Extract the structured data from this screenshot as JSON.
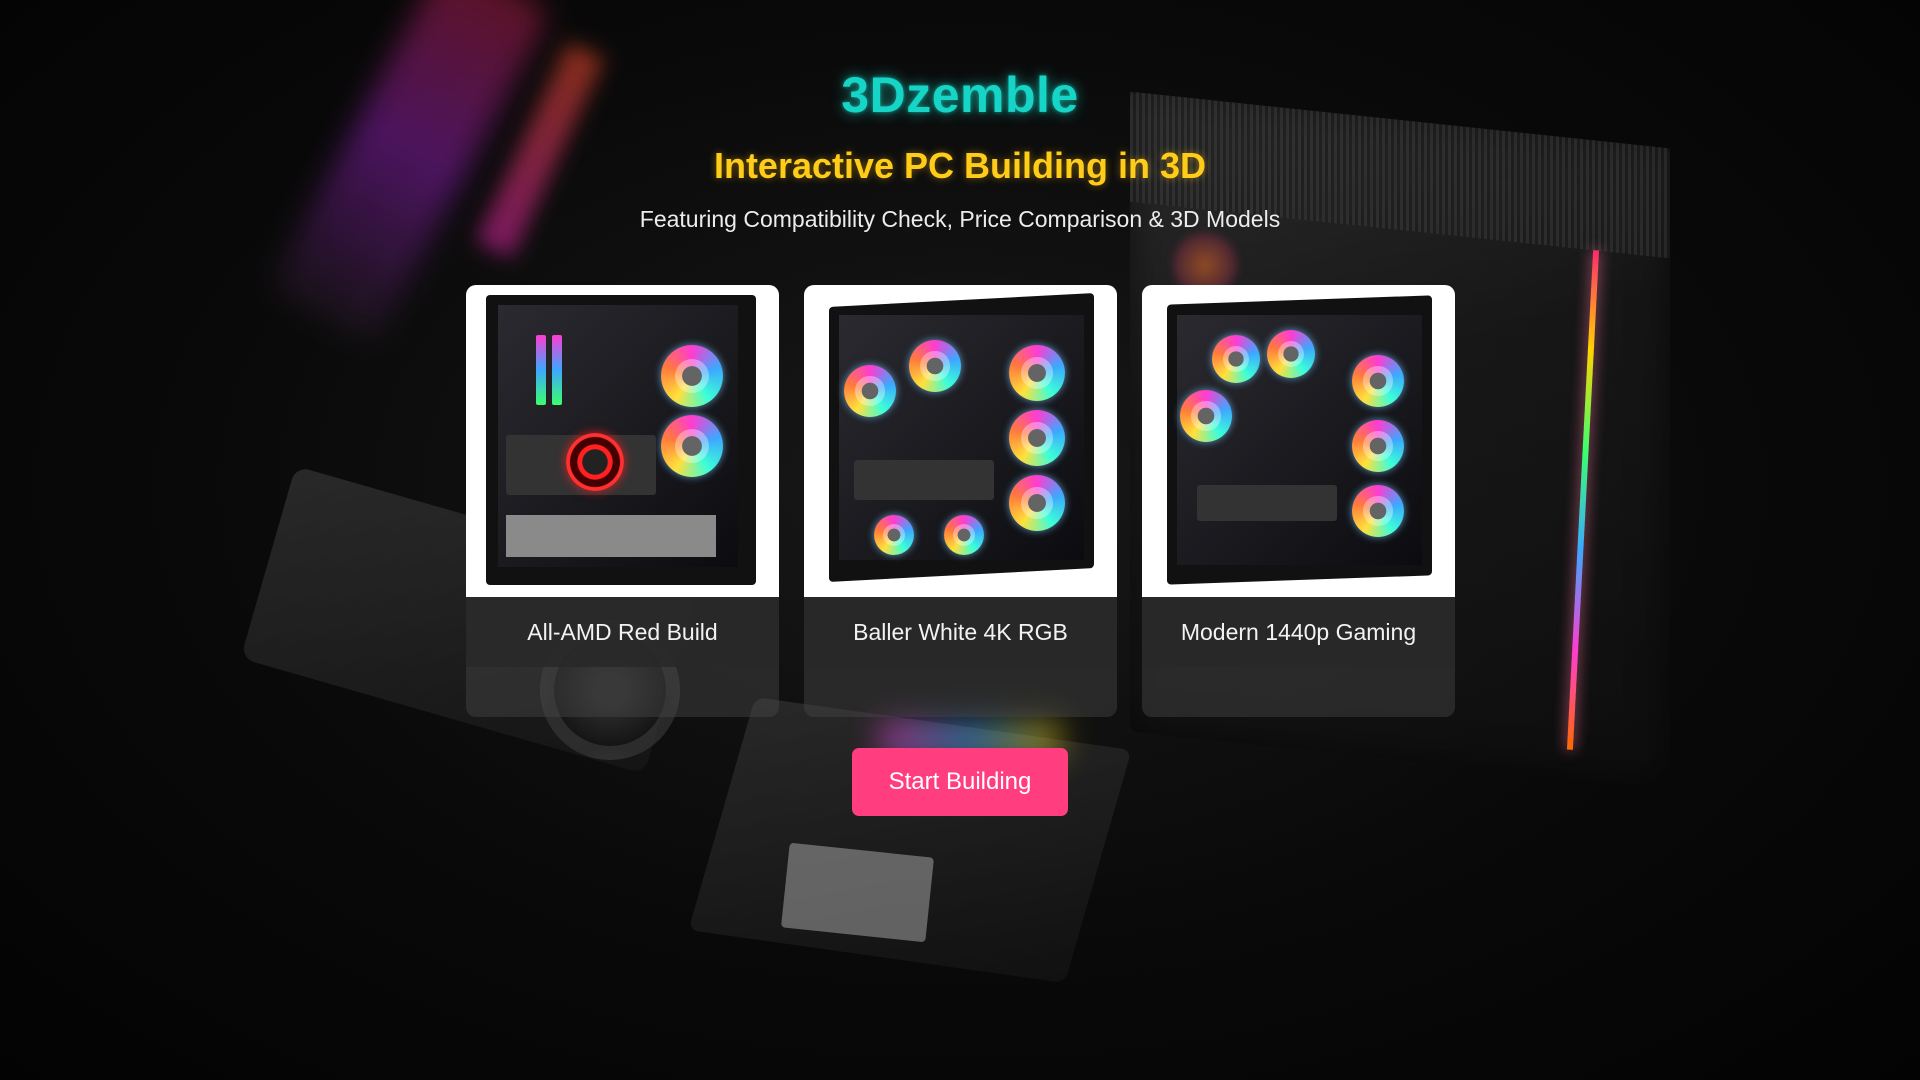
{
  "hero": {
    "brand": "3Dzemble",
    "tagline": "Interactive PC Building in 3D",
    "subtitle": "Featuring Compatibility Check, Price Comparison & 3D Models"
  },
  "builds": [
    {
      "label": "All-AMD Red Build"
    },
    {
      "label": "Baller White 4K RGB"
    },
    {
      "label": "Modern 1440p Gaming"
    }
  ],
  "cta": {
    "label": "Start Building"
  },
  "colors": {
    "brand": "#17d5c6",
    "tagline": "#ffcc1a",
    "cta": "#ff3d7f",
    "background": "#050505"
  }
}
